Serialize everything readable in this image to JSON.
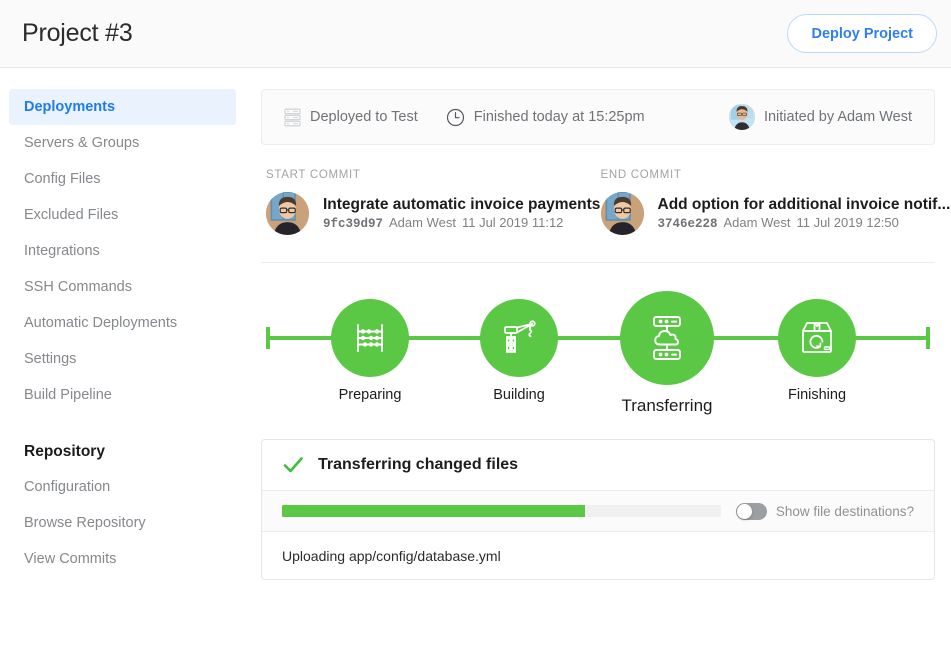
{
  "header": {
    "title": "Project #3",
    "deploy_label": "Deploy Project",
    "accent_blue": "#2d7ff0"
  },
  "sidebar": {
    "items": [
      {
        "label": "Deployments",
        "active": true
      },
      {
        "label": "Servers & Groups",
        "active": false
      },
      {
        "label": "Config Files",
        "active": false
      },
      {
        "label": "Excluded Files",
        "active": false
      },
      {
        "label": "Integrations",
        "active": false
      },
      {
        "label": "SSH Commands",
        "active": false
      },
      {
        "label": "Automatic Deployments",
        "active": false
      },
      {
        "label": "Settings",
        "active": false
      },
      {
        "label": "Build Pipeline",
        "active": false
      }
    ],
    "section_heading": "Repository",
    "repo_items": [
      {
        "label": "Configuration"
      },
      {
        "label": "Browse Repository"
      },
      {
        "label": "View Commits"
      }
    ]
  },
  "status": {
    "environment": "Deployed to Test",
    "finished": "Finished today at 15:25pm",
    "initiator": "Initiated by Adam West"
  },
  "commits": {
    "start": {
      "label": "START COMMIT",
      "title": "Integrate automatic invoice payments",
      "hash": "9fc39d97",
      "author": "Adam West",
      "date": "11 Jul 2019 11:12"
    },
    "end": {
      "label": "END COMMIT",
      "title": "Add option for additional invoice notif...",
      "hash": "3746e228",
      "author": "Adam West",
      "date": "11 Jul 2019 12:50"
    }
  },
  "stepper": {
    "green": "#5ac845",
    "steps": [
      {
        "label": "Preparing",
        "icon": "abacus-icon",
        "active": false
      },
      {
        "label": "Building",
        "icon": "crane-icon",
        "active": false
      },
      {
        "label": "Transferring",
        "icon": "server-cloud-icon",
        "active": true
      },
      {
        "label": "Finishing",
        "icon": "package-refresh-icon",
        "active": false
      }
    ]
  },
  "transfer_panel": {
    "title": "Transferring changed files",
    "progress_percent": 69,
    "toggle_label": "Show file destinations?",
    "toggle_on": false,
    "log_line": "Uploading app/config/database.yml"
  }
}
